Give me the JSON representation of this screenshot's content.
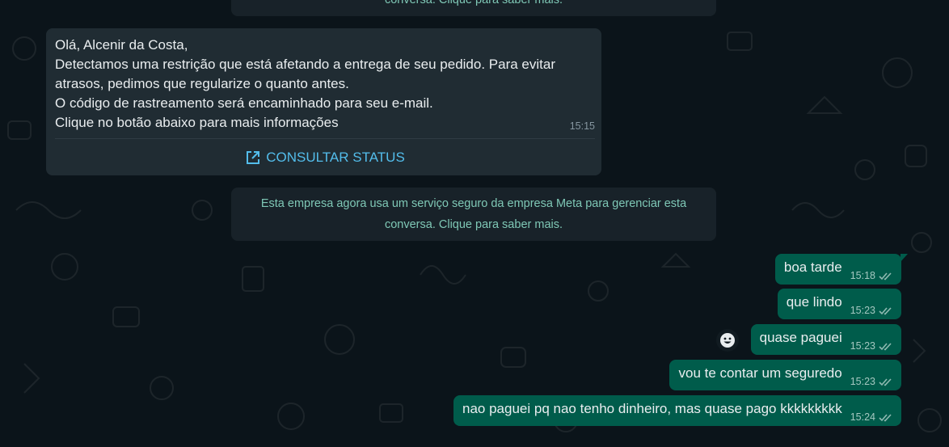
{
  "system_notes": {
    "top_partial": "conversa. Clique para saber mais.",
    "meta_notice": "Esta empresa agora usa um serviço seguro da empresa Meta para gerenciar esta conversa. Clique para saber mais."
  },
  "incoming_message": {
    "text": "Olá, Alcenir da Costa,\nDetectamos uma restrição que está afetando a entrega de seu pedido. Para evitar atrasos, pedimos que regularize o quanto antes.\nO código de rastreamento será encaminhado para seu e-mail.\nClique no botão abaixo para mais informações",
    "time": "15:15",
    "button_label": "CONSULTAR STATUS",
    "button_icon": "external-link-icon"
  },
  "outgoing_messages": [
    {
      "text": "boa tarde",
      "time": "15:18",
      "status_icon": "double-check-icon"
    },
    {
      "text": "que lindo",
      "time": "15:23",
      "status_icon": "double-check-icon"
    },
    {
      "text": "quase paguei",
      "time": "15:23",
      "status_icon": "double-check-icon"
    },
    {
      "text": "vou te contar um seguredo",
      "time": "15:23",
      "status_icon": "double-check-icon"
    },
    {
      "text": "nao paguei pq nao tenho dinheiro, mas quase pago kkkkkkkkk",
      "time": "15:24",
      "status_icon": "double-check-icon"
    }
  ],
  "reaction_button": {
    "icon": "emoji-smile-icon"
  },
  "colors": {
    "background": "#0b141a",
    "incoming_bubble": "#202c33",
    "outgoing_bubble": "#005c4b",
    "system_note_bg": "#182229",
    "system_note_text": "#7fc8b6",
    "link_blue": "#53bdeb",
    "read_ticks": "#8fb9b1"
  }
}
